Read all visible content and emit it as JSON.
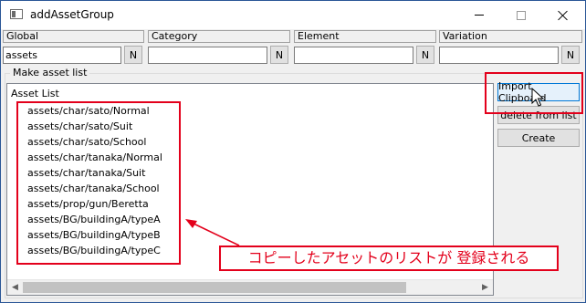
{
  "window": {
    "title": "addAssetGroup"
  },
  "fields": [
    {
      "header": "Global",
      "value": "assets",
      "n_label": "N"
    },
    {
      "header": "Category",
      "value": "",
      "n_label": "N"
    },
    {
      "header": "Element",
      "value": "",
      "n_label": "N"
    },
    {
      "header": "Variation",
      "value": "",
      "n_label": "N"
    }
  ],
  "group": {
    "label": "Make asset list"
  },
  "asset_list": {
    "title": "Asset List",
    "items": [
      "assets/char/sato/Normal",
      "assets/char/sato/Suit",
      "assets/char/sato/School",
      "assets/char/tanaka/Normal",
      "assets/char/tanaka/Suit",
      "assets/char/tanaka/School",
      "assets/prop/gun/Beretta",
      "assets/BG/buildingA/typeA",
      "assets/BG/buildingA/typeB",
      "assets/BG/buildingA/typeC"
    ]
  },
  "buttons": {
    "import_clipboard": "Import Clipboard",
    "delete_from_list": "delete from list",
    "create": "Create"
  },
  "annotation": {
    "text": "コピーしたアセットのリストが 登録される",
    "color": "#e3001b"
  },
  "icons": {
    "app": "window-icon",
    "minimize": "minimize-icon",
    "maximize": "maximize-icon",
    "close": "close-icon",
    "cursor": "mouse-pointer-icon"
  }
}
